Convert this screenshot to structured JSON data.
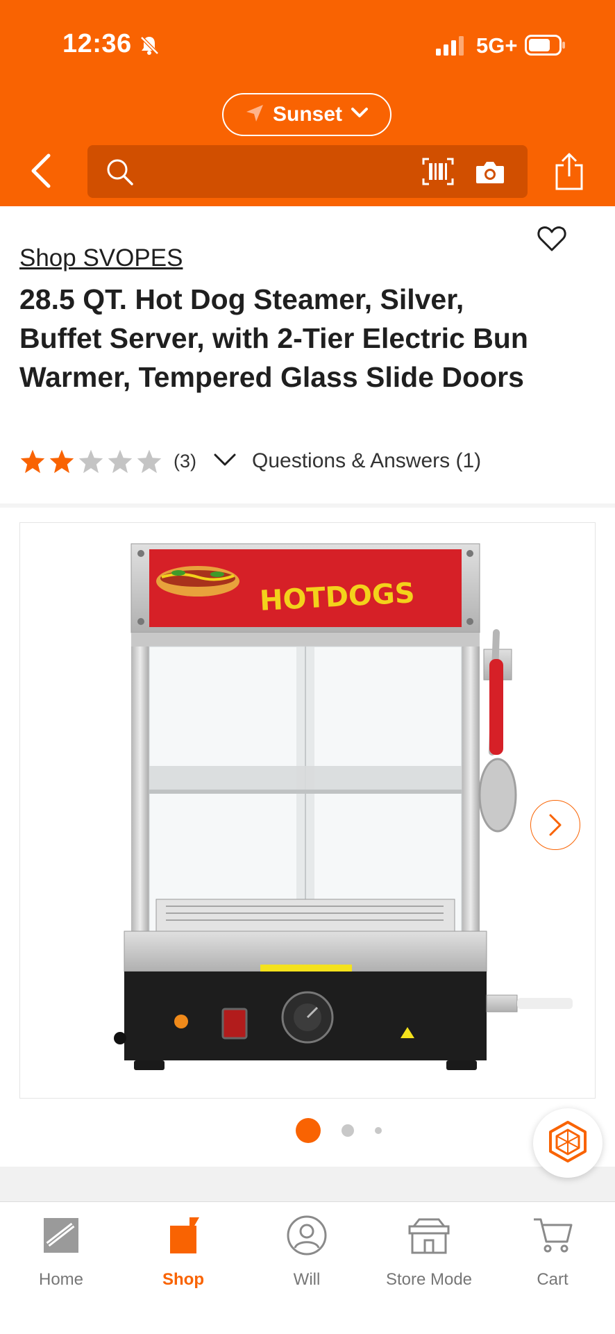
{
  "status_bar": {
    "time": "12:36",
    "network": "5G+"
  },
  "header": {
    "location": "Sunset",
    "search_placeholder": ""
  },
  "product": {
    "brand_link": "Shop SVOPES",
    "title": "28.5 QT. Hot Dog Steamer, Silver, Buffet Server, with 2-Tier Electric Bun Warmer, Tempered Glass Slide Doors",
    "rating": 2,
    "rating_max": 5,
    "review_count": "(3)",
    "qa_label": "Questions & Answers (1)"
  },
  "product_image": {
    "sign_text": "HOTDOGS",
    "carousel_total": 3,
    "carousel_index": 0
  },
  "tabs": [
    {
      "label": "Home",
      "icon": "home-depot-logo-icon"
    },
    {
      "label": "Shop",
      "icon": "shop-bag-icon"
    },
    {
      "label": "Will",
      "icon": "user-icon"
    },
    {
      "label": "Store Mode",
      "icon": "store-icon"
    },
    {
      "label": "Cart",
      "icon": "cart-icon"
    }
  ],
  "colors": {
    "brand_orange": "#f96302",
    "search_bg": "#d14f00",
    "star_empty": "#c4c4c4"
  }
}
